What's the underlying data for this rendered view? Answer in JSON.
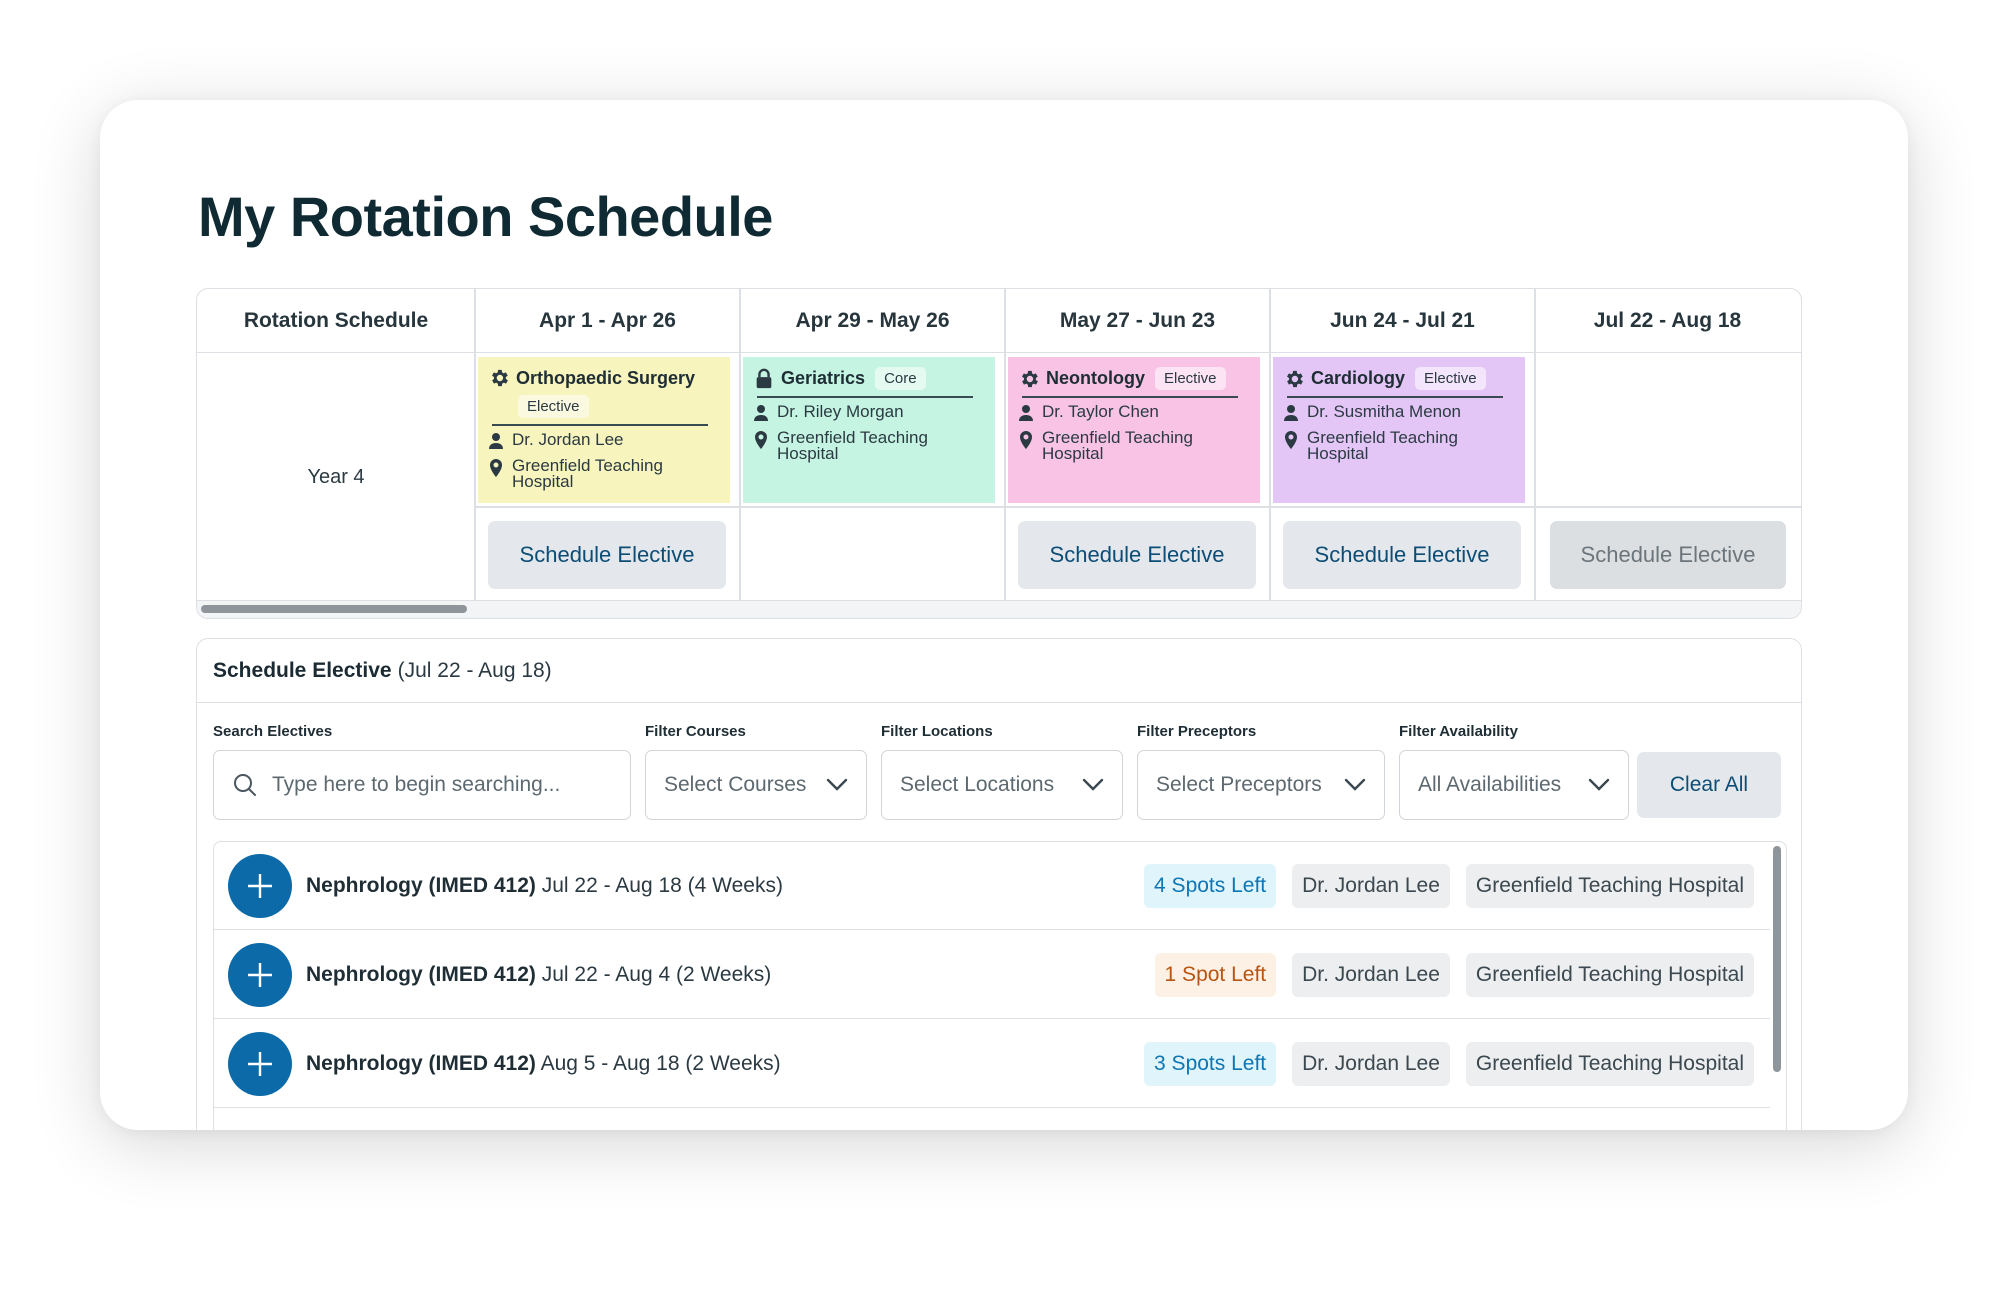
{
  "page_title": "My Rotation Schedule",
  "schedule": {
    "corner_header": "Rotation Schedule",
    "year_label": "Year 4",
    "periods": [
      "Apr 1 - Apr 26",
      "Apr 29 - May 26",
      "May 27 - Jun 23",
      "Jun 24 - Jul 21",
      "Jul  22 - Aug 18"
    ],
    "blocks": [
      {
        "name": "Orthopaedic Surgery",
        "tag": "Elective",
        "preceptor": "Dr. Jordan Lee",
        "location_line1": "Greenfield Teaching",
        "location_line2": "Hospital",
        "color": "#f7f4bd",
        "icon": "gear-icon"
      },
      {
        "name": "Geriatrics",
        "tag": "Core",
        "preceptor": "Dr. Riley Morgan",
        "location_line1": "Greenfield Teaching",
        "location_line2": "Hospital",
        "color": "#c5f5e2",
        "icon": "lock-icon"
      },
      {
        "name": "Neontology",
        "tag": "Elective",
        "preceptor": "Dr. Taylor Chen",
        "location_line1": "Greenfield Teaching",
        "location_line2": "Hospital",
        "color": "#f9c3e6",
        "icon": "gear-icon"
      },
      {
        "name": "Cardiology",
        "tag": "Elective",
        "preceptor": "Dr. Susmitha Menon",
        "location_line1": "Greenfield Teaching",
        "location_line2": "Hospital",
        "color": "#e4c6f6",
        "icon": "gear-icon"
      }
    ],
    "schedule_button_label": "Schedule Elective"
  },
  "elective_panel": {
    "title": "Schedule Elective",
    "range": "(Jul 22 - Aug 18)",
    "filters": {
      "search_label": "Search Electives",
      "search_placeholder": "Type here to begin searching...",
      "courses_label": "Filter Courses",
      "courses_value": "Select Courses",
      "locations_label": "Filter Locations",
      "locations_value": "Select Locations",
      "preceptors_label": "Filter Preceptors",
      "preceptors_value": "Select Preceptors",
      "availability_label": "Filter Availability",
      "availability_value": "All Availabilities",
      "clear_label": "Clear All"
    },
    "results": [
      {
        "course": "Nephrology (IMED 412)",
        "dates": "Jul 22 - Aug 18 (4 Weeks)",
        "spots": "4 Spots Left",
        "spots_color": "blue",
        "preceptor": "Dr. Jordan Lee",
        "location": "Greenfield Teaching Hospital"
      },
      {
        "course": "Nephrology (IMED 412)",
        "dates": "Jul 22 - Aug 4 (2 Weeks)",
        "spots": "1 Spot Left",
        "spots_color": "orange",
        "preceptor": "Dr. Jordan Lee",
        "location": "Greenfield Teaching Hospital"
      },
      {
        "course": "Nephrology (IMED 412)",
        "dates": "Aug 5 - Aug 18 (2 Weeks)",
        "spots": "3 Spots Left",
        "spots_color": "blue",
        "preceptor": "Dr. Jordan Lee",
        "location": "Greenfield Teaching Hospital"
      }
    ]
  },
  "colors": {
    "primary": "#0d6aa8",
    "button_text": "#0c4d76",
    "title": "#0f2a33"
  }
}
